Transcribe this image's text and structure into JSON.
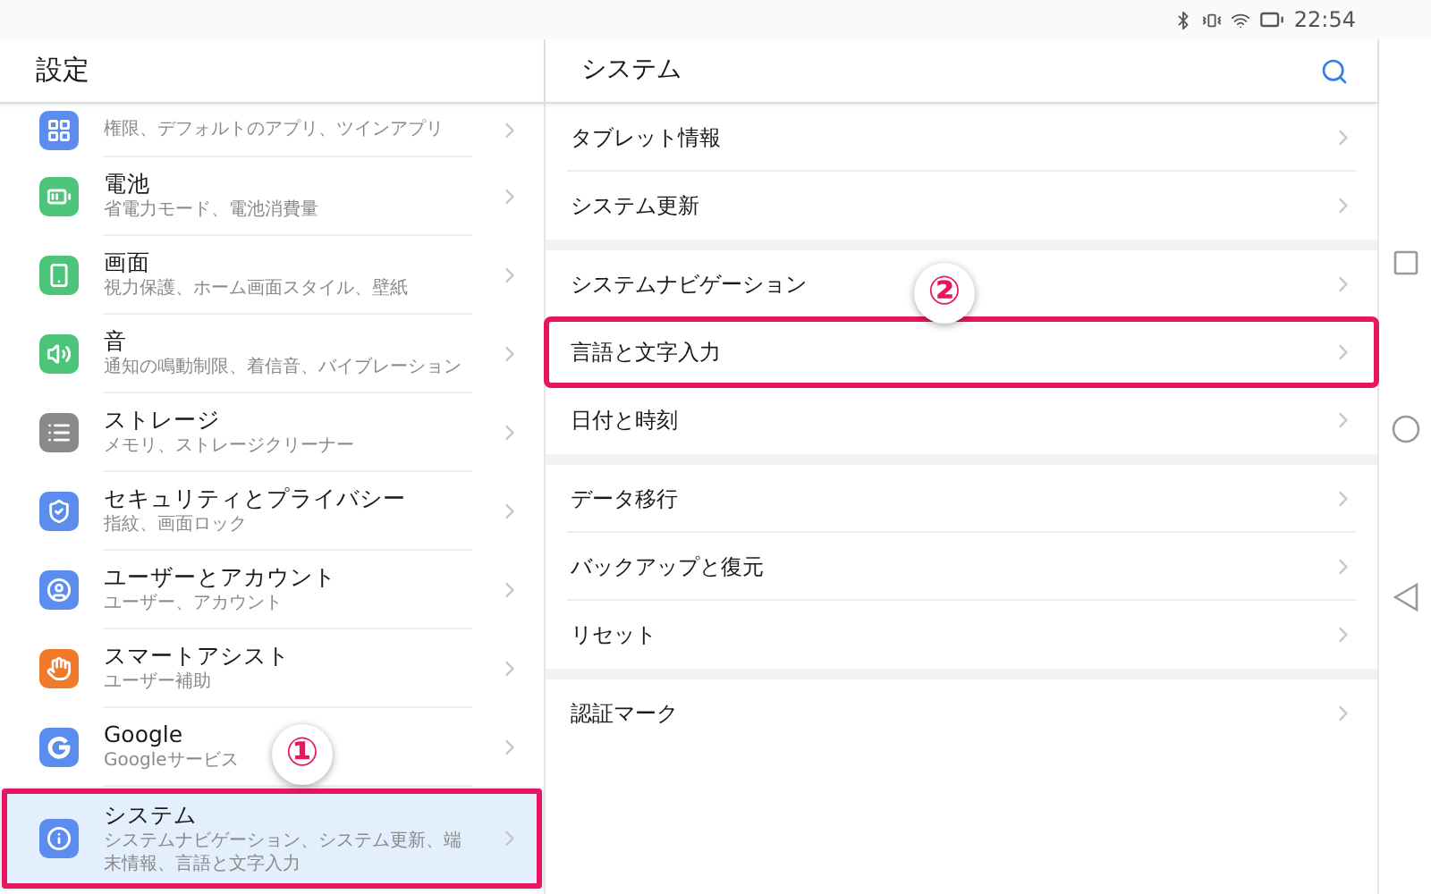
{
  "status_bar": {
    "time": "22:54"
  },
  "settings": {
    "title": "設定",
    "items": [
      {
        "subtitle": "権限、デフォルトのアプリ、ツインアプリ",
        "selected": false,
        "highlighted": false
      },
      {
        "title": "電池",
        "subtitle": "省電力モード、電池消費量",
        "selected": false,
        "highlighted": false
      },
      {
        "title": "画面",
        "subtitle": "視力保護、ホーム画面スタイル、壁紙",
        "selected": false,
        "highlighted": false
      },
      {
        "title": "音",
        "subtitle": "通知の鳴動制限、着信音、バイブレーション",
        "selected": false,
        "highlighted": false
      },
      {
        "title": "ストレージ",
        "subtitle": "メモリ、ストレージクリーナー",
        "selected": false,
        "highlighted": false
      },
      {
        "title": "セキュリティとプライバシー",
        "subtitle": "指紋、画面ロック",
        "selected": false,
        "highlighted": false
      },
      {
        "title": "ユーザーとアカウント",
        "subtitle": "ユーザー、アカウント",
        "selected": false,
        "highlighted": false
      },
      {
        "title": "スマートアシスト",
        "subtitle": "ユーザー補助",
        "selected": false,
        "highlighted": false
      },
      {
        "title": "Google",
        "subtitle": "Googleサービス",
        "selected": false,
        "highlighted": false
      },
      {
        "title": "システム",
        "subtitle": "システムナビゲーション、システム更新、端末情報、言語と文字入力",
        "selected": true,
        "highlighted": true,
        "callout": "①"
      }
    ]
  },
  "system": {
    "title": "システム",
    "groups": [
      {
        "rows": [
          {
            "label": "タブレット情報",
            "highlighted": false
          },
          {
            "label": "システム更新",
            "highlighted": false
          }
        ]
      },
      {
        "rows": [
          {
            "label": "システムナビゲーション",
            "highlighted": false
          },
          {
            "label": "言語と文字入力",
            "highlighted": true,
            "callout": "②"
          },
          {
            "label": "日付と時刻",
            "highlighted": false
          }
        ]
      },
      {
        "rows": [
          {
            "label": "データ移行",
            "highlighted": false
          },
          {
            "label": "バックアップと復元",
            "highlighted": false
          },
          {
            "label": "リセット",
            "highlighted": false
          }
        ]
      },
      {
        "rows": [
          {
            "label": "認証マーク",
            "highlighted": false
          }
        ]
      }
    ]
  }
}
